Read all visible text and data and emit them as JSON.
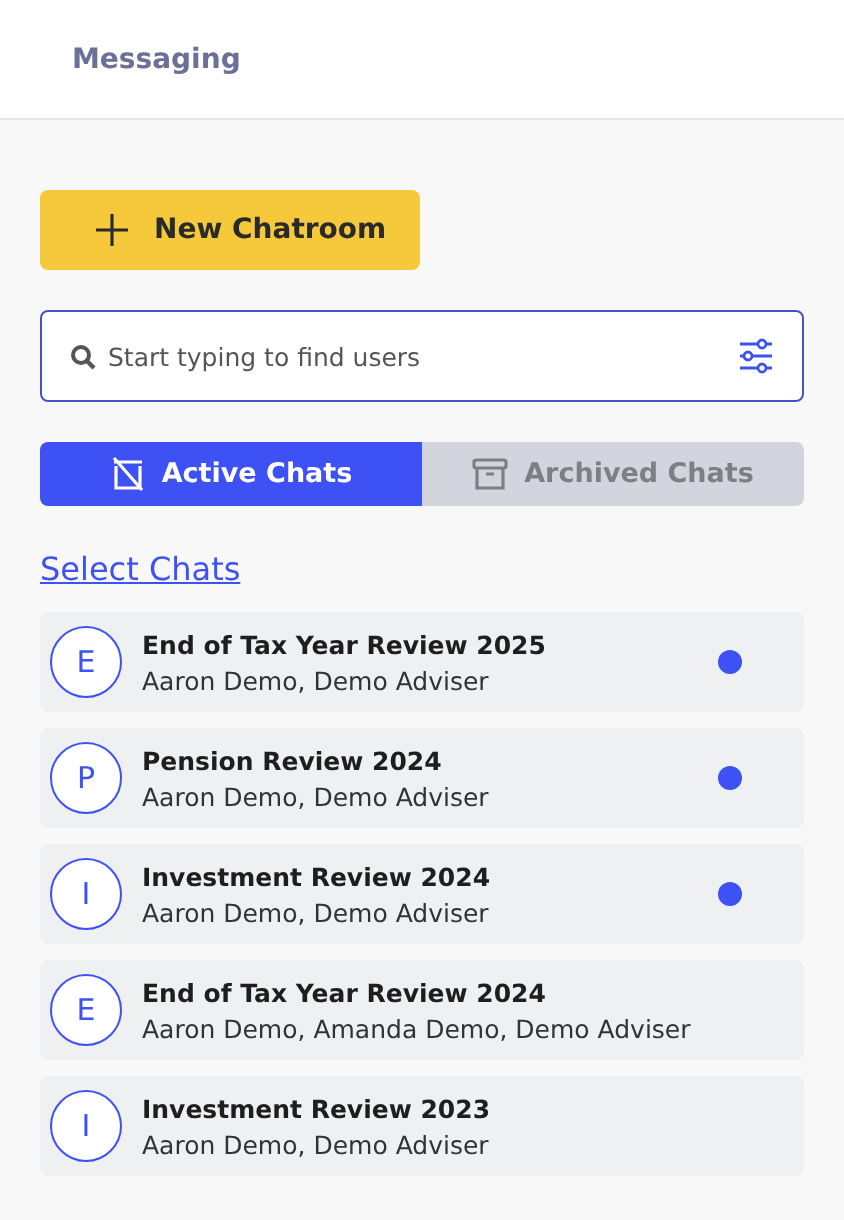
{
  "header": {
    "title": "Messaging"
  },
  "new_button": {
    "label": "New Chatroom"
  },
  "search": {
    "placeholder": "Start typing to find users"
  },
  "tabs": [
    {
      "label": "Active Chats",
      "selected": true,
      "kind": "active"
    },
    {
      "label": "Archived Chats",
      "selected": false,
      "kind": "archived"
    }
  ],
  "select_link": "Select Chats",
  "chats": [
    {
      "initial": "E",
      "title": "End of Tax Year Review 2025",
      "members": "Aaron Demo, Demo Adviser",
      "unread": true
    },
    {
      "initial": "P",
      "title": "Pension Review 2024",
      "members": "Aaron Demo, Demo Adviser",
      "unread": true
    },
    {
      "initial": "I",
      "title": "Investment Review 2024",
      "members": "Aaron Demo, Demo Adviser",
      "unread": true
    },
    {
      "initial": "E",
      "title": "End of Tax Year Review 2024",
      "members": "Aaron Demo, Amanda Demo, Demo Adviser",
      "unread": false
    },
    {
      "initial": "I",
      "title": "Investment Review 2023",
      "members": "Aaron Demo, Demo Adviser",
      "unread": false
    }
  ]
}
